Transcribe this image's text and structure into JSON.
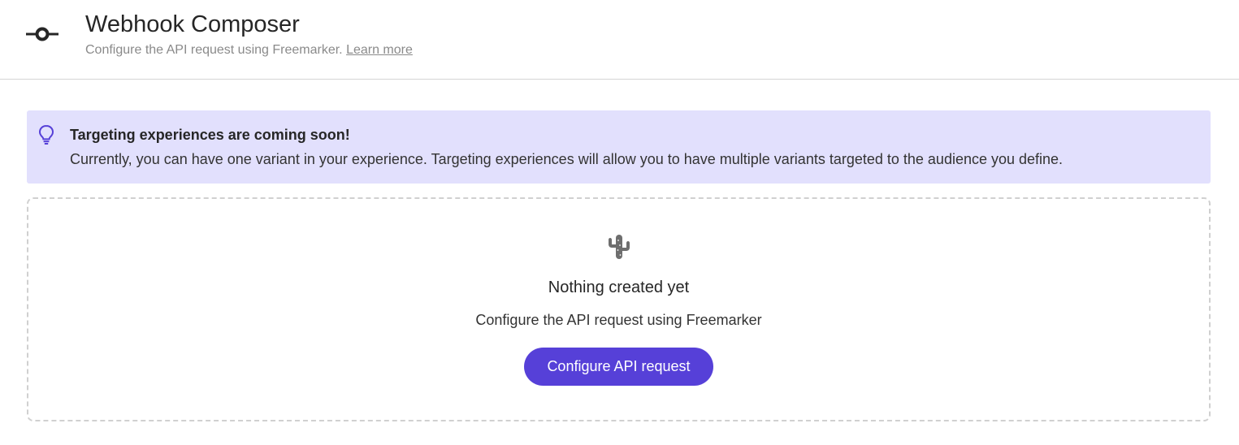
{
  "header": {
    "icon": "webhook-icon",
    "title": "Webhook Composer",
    "subtitle": "Configure the API request using Freemarker.",
    "learn_more": "Learn more"
  },
  "banner": {
    "icon": "lightbulb-icon",
    "title": "Targeting experiences are coming soon!",
    "text": "Currently, you can have one variant in your experience. Targeting experiences will allow you to have multiple variants targeted to the audience you define.",
    "background": "#e2e0fd",
    "icon_color": "#5640d8"
  },
  "empty_state": {
    "icon": "cactus-icon",
    "title": "Nothing created yet",
    "text": "Configure the API request using Freemarker",
    "button_label": "Configure API request",
    "button_color": "#5640d8"
  }
}
